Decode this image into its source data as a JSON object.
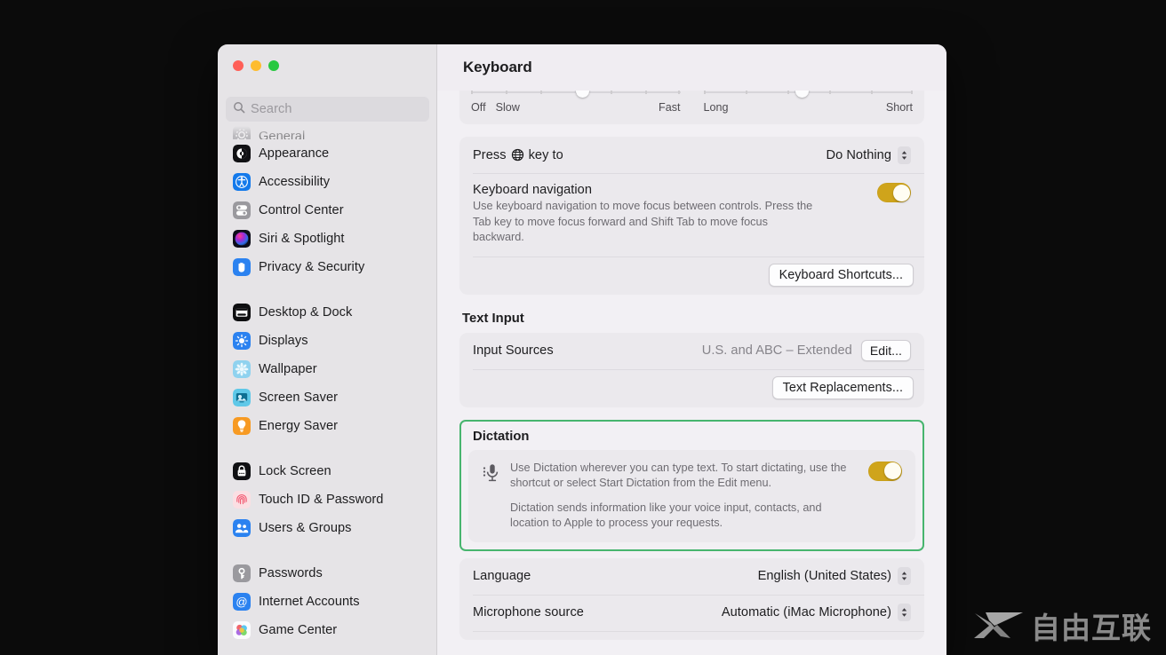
{
  "window": {
    "title": "Keyboard",
    "traffic_lights": [
      "close",
      "minimize",
      "zoom"
    ]
  },
  "search": {
    "placeholder": "Search",
    "icon": "search-icon"
  },
  "sidebar": {
    "groups": [
      {
        "items": [
          {
            "label": "General",
            "icon": "general-icon",
            "clipped": true
          },
          {
            "label": "Appearance",
            "icon": "appearance-icon"
          },
          {
            "label": "Accessibility",
            "icon": "accessibility-icon"
          },
          {
            "label": "Control Center",
            "icon": "control-center-icon"
          },
          {
            "label": "Siri & Spotlight",
            "icon": "siri-icon"
          },
          {
            "label": "Privacy & Security",
            "icon": "privacy-security-icon"
          }
        ]
      },
      {
        "items": [
          {
            "label": "Desktop & Dock",
            "icon": "desktop-dock-icon"
          },
          {
            "label": "Displays",
            "icon": "displays-icon"
          },
          {
            "label": "Wallpaper",
            "icon": "wallpaper-icon"
          },
          {
            "label": "Screen Saver",
            "icon": "screen-saver-icon"
          },
          {
            "label": "Energy Saver",
            "icon": "energy-saver-icon"
          }
        ]
      },
      {
        "items": [
          {
            "label": "Lock Screen",
            "icon": "lock-screen-icon"
          },
          {
            "label": "Touch ID & Password",
            "icon": "touch-id-icon"
          },
          {
            "label": "Users & Groups",
            "icon": "users-groups-icon"
          }
        ]
      },
      {
        "items": [
          {
            "label": "Passwords",
            "icon": "passwords-icon"
          },
          {
            "label": "Internet Accounts",
            "icon": "internet-accounts-icon"
          },
          {
            "label": "Game Center",
            "icon": "game-center-icon"
          }
        ]
      }
    ]
  },
  "main": {
    "sliders": {
      "key_repeat": {
        "left_labels": [
          "Off",
          "Slow"
        ],
        "right_label": "Fast",
        "knob_percent": 54
      },
      "delay_until_repeat": {
        "left_label": "Long",
        "right_label": "Short",
        "knob_percent": 49
      }
    },
    "globe_key_row": {
      "label_prefix": "Press",
      "label_suffix": "key to",
      "globe_icon": "globe-icon",
      "value": "Do Nothing"
    },
    "keyboard_navigation": {
      "title": "Keyboard navigation",
      "description": "Use keyboard navigation to move focus between controls. Press the Tab key to move focus forward and Shift Tab to move focus backward.",
      "toggle_on": true
    },
    "keyboard_shortcuts_button": "Keyboard Shortcuts...",
    "text_input": {
      "section_title": "Text Input",
      "input_sources_label": "Input Sources",
      "input_sources_value": "U.S. and ABC – Extended",
      "edit_button": "Edit...",
      "text_replacements_button": "Text Replacements..."
    },
    "dictation": {
      "section_title": "Dictation",
      "mic_icon": "microphone-icon",
      "description_1": "Use Dictation wherever you can type text. To start dictating, use the shortcut or select Start Dictation from the Edit menu.",
      "description_2": "Dictation sends information like your voice input, contacts, and location to Apple to process your requests.",
      "toggle_on": true,
      "highlight_color": "#47b56e"
    },
    "dictation_settings": {
      "language_label": "Language",
      "language_value": "English (United States)",
      "microphone_label": "Microphone source",
      "microphone_value": "Automatic (iMac Microphone)"
    }
  },
  "watermark": {
    "text": "自由互联",
    "logo": "x-logo"
  },
  "colors": {
    "toggle_on": "#cfa41b",
    "highlight_green": "#47b56e",
    "window_bg": "#f2f0f4",
    "sidebar_bg": "#e6e4e7",
    "card_bg": "#ebe9ed"
  }
}
